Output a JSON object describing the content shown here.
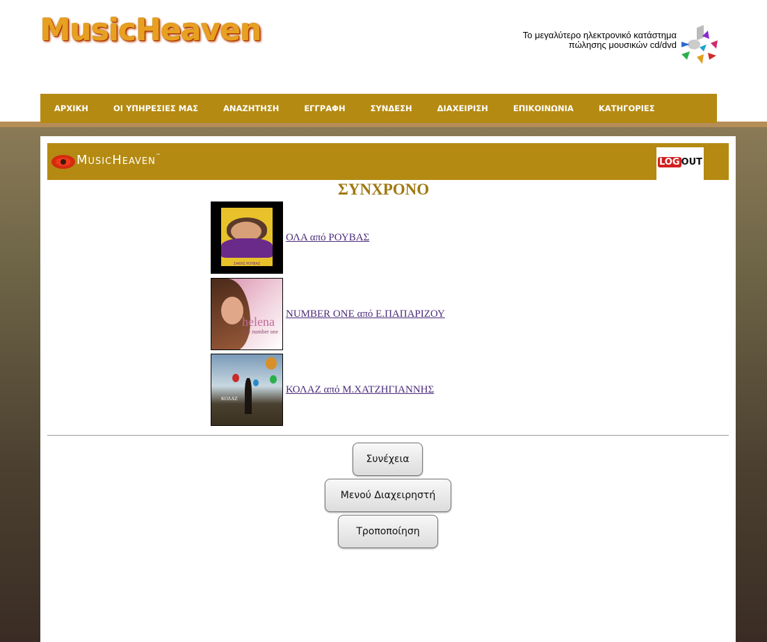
{
  "header": {
    "logo_text": "MusicHeaven",
    "tagline_line1": "Το μεγαλύτερο ηλεκτρονικό κατάστημα",
    "tagline_line2": "πώλησης μουσικών cd/dvd"
  },
  "nav": {
    "items": [
      "ΑΡΧΙΚΗ",
      "ΟΙ ΥΠΗΡΕΣΙΕΣ ΜΑΣ",
      "ΑΝΑΖΗΤΗΣΗ",
      "ΕΓΓΡΑΦΗ",
      "ΣΥΝΔΕΣΗ",
      "ΔΙΑΧΕΙΡΙΣΗ",
      "ΕΠΙΚΟΙΝΩΝΙΑ",
      "ΚΑΤΗΓΟΡΙΕΣ"
    ]
  },
  "banner": {
    "brand": "MusicHeaven",
    "trademark": "™",
    "logout_log": "LOG",
    "logout_out": "OUT"
  },
  "category": {
    "title": "ΣΥΝΧΡΟΝΟ"
  },
  "albums": [
    {
      "link": "ΟΛΑ από ΡΟΥΒΑΣ",
      "cover_text": "ΣΑΚΗΣ ΡΟΥΒΑΣ"
    },
    {
      "link": "NUMBER ONE από Ε.ΠΑΠΑΡΙΖΟΥ",
      "cover_text": "helena",
      "cover_subtext": "my number one"
    },
    {
      "link": "ΚΟΛΑΖ από Μ.ΧΑΤΖΗΓΙΑΝΝΗΣ",
      "cover_text": "ΚΟΛΑΖ"
    }
  ],
  "buttons": {
    "continue": "Συνέχεια",
    "admin_menu": "Μενού Διαχειρηστή",
    "modify": "Τροποποίηση"
  },
  "colors": {
    "nav_bg": "#b48a12",
    "title": "#a07812",
    "link": "#4a2a7a"
  }
}
